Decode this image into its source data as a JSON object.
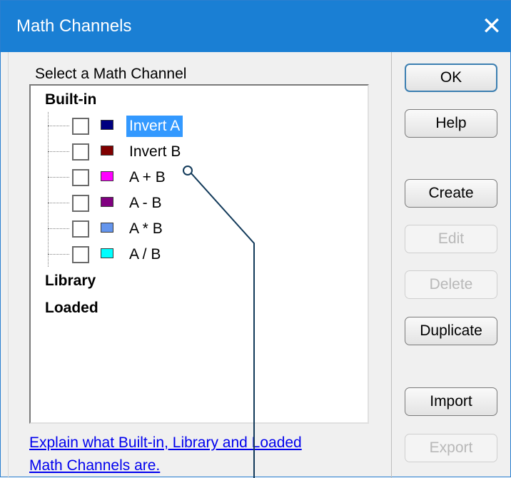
{
  "window": {
    "title": "Math Channels",
    "close_glyph": "✕"
  },
  "list": {
    "label": "Select a Math Channel",
    "groups": {
      "builtin": "Built-in",
      "library": "Library",
      "loaded": "Loaded"
    },
    "items": [
      {
        "label": "Invert A",
        "color": "#000080",
        "selected": true,
        "checked": false
      },
      {
        "label": "Invert B",
        "color": "#800000",
        "selected": false,
        "checked": false
      },
      {
        "label": "A + B",
        "color": "#ff00ff",
        "selected": false,
        "checked": false
      },
      {
        "label": "A - B",
        "color": "#800080",
        "selected": false,
        "checked": false
      },
      {
        "label": "A * B",
        "color": "#6495ed",
        "selected": false,
        "checked": false
      },
      {
        "label": "A / B",
        "color": "#00ffff",
        "selected": false,
        "checked": false
      }
    ]
  },
  "help_link": {
    "line1": "Explain what Built-in, Library and Loaded",
    "line2": "Math Channels are."
  },
  "buttons": {
    "ok": "OK",
    "help": "Help",
    "create": "Create",
    "edit": "Edit",
    "delete": "Delete",
    "duplicate": "Duplicate",
    "import": "Import",
    "export": "Export"
  }
}
